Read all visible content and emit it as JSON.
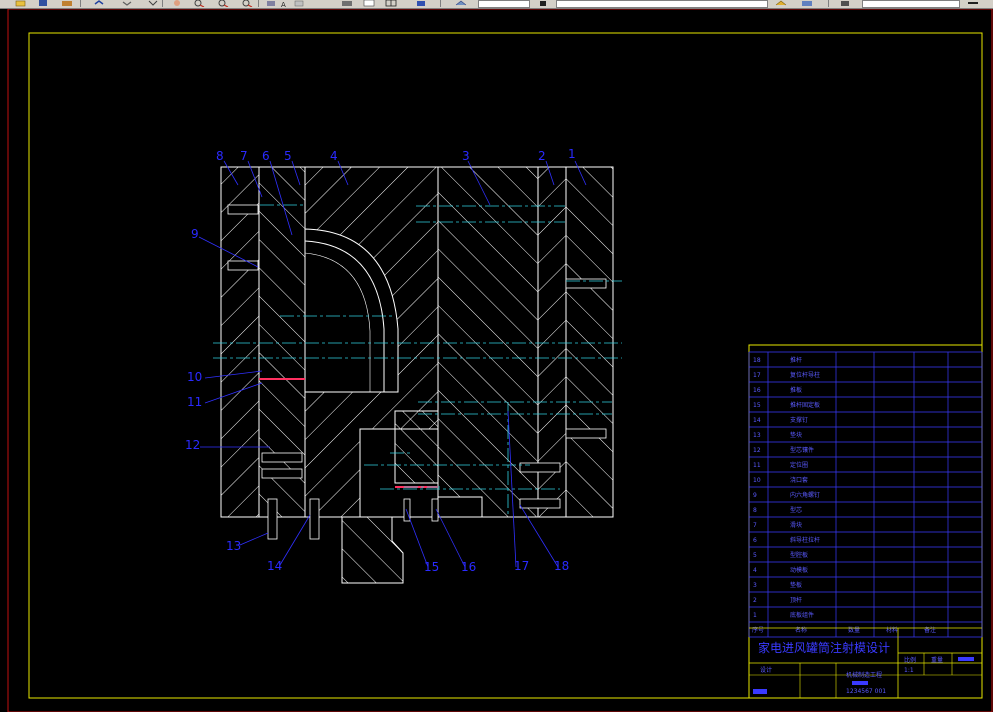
{
  "toolbar": {
    "buttons": [
      "open-icon",
      "save-icon",
      "plot-icon",
      "undo-icon",
      "redo-icon",
      "pan-icon",
      "zoom-realtime-icon",
      "zoom-window-icon",
      "zoom-previous-icon",
      "properties-icon",
      "text-style-icon",
      "dim-style-icon",
      "layer-icon",
      "table-icon",
      "help-icon",
      "3d-orbit-icon",
      "shade-icon",
      "layer-state-icon",
      "color-icon",
      "linetype-icon"
    ]
  },
  "drawing": {
    "callouts": [
      "8",
      "7",
      "6",
      "5",
      "4",
      "3",
      "2",
      "1",
      "9",
      "10",
      "11",
      "12",
      "13",
      "14",
      "15",
      "16",
      "17",
      "18"
    ],
    "bom_rows": [
      {
        "no": "18",
        "name": "推杆"
      },
      {
        "no": "17",
        "name": "复位杆导柱"
      },
      {
        "no": "16",
        "name": "推板"
      },
      {
        "no": "15",
        "name": "推杆固定板"
      },
      {
        "no": "14",
        "name": "支撑钉"
      },
      {
        "no": "13",
        "name": "垫块"
      },
      {
        "no": "12",
        "name": "型芯镶件"
      },
      {
        "no": "11",
        "name": "定位圈"
      },
      {
        "no": "10",
        "name": "浇口套"
      },
      {
        "no": "9",
        "name": "内六角螺钉"
      },
      {
        "no": "8",
        "name": "型芯"
      },
      {
        "no": "7",
        "name": "滑块"
      },
      {
        "no": "6",
        "name": "斜导柱拉杆"
      },
      {
        "no": "5",
        "name": "型腔板"
      },
      {
        "no": "4",
        "name": "动模板"
      },
      {
        "no": "3",
        "name": "垫板"
      },
      {
        "no": "2",
        "name": "顶杆"
      },
      {
        "no": "1",
        "name": "底板组件"
      }
    ],
    "bom_header": [
      "序号",
      "名称",
      "数量",
      "材料",
      "备注"
    ],
    "title": "家电进风罐筒注射模设计",
    "scale_label": "比例",
    "weight_label": "重量",
    "scale_value": "1:1",
    "designer_label": "设计",
    "school": "机械制造工程",
    "drawing_no": "1234567 001"
  }
}
